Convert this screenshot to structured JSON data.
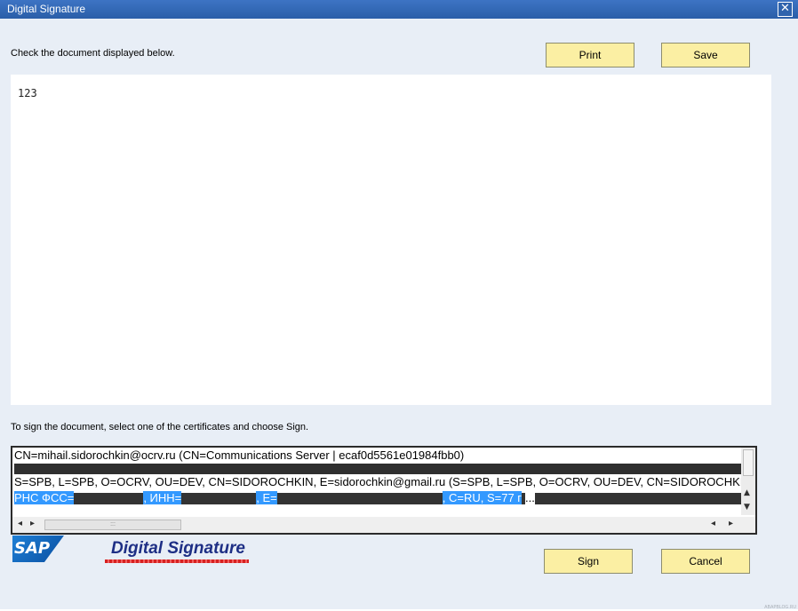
{
  "window": {
    "title": "Digital Signature",
    "close_glyph": "✕"
  },
  "instructions": {
    "check": "Check the document displayed below.",
    "sign": "To sign the document, select one of the certificates and choose Sign."
  },
  "toolbar": {
    "print_label": "Print",
    "save_label": "Save"
  },
  "document": {
    "content": "123"
  },
  "certificates": [
    {
      "text": "CN=mihail.sidorochkin@ocrv.ru (CN=Communications Server | ecaf0d5561e01984fbb0)"
    },
    {
      "text": "S=SPB, L=SPB, O=OCRV, OU=DEV, CN=SIDOROCHKIN, E=sidorochkin@gmail.ru (S=SPB, L=SPB, O=OCRV, OU=DEV, CN=SIDOROCHKIN"
    },
    {
      "part1": "РНС ФСС=",
      "part2": ", ИНН=",
      "part3": ", E=",
      "part4": ", C=RU, S=77 г",
      "part5": "..."
    }
  ],
  "footer": {
    "sap_logo": "SAP",
    "brand": "Digital Signature",
    "sign_label": "Sign",
    "cancel_label": "Cancel",
    "watermark": "ABAPBLOG.RU"
  },
  "colors": {
    "title_bar": "#2f63ad",
    "dialog_bg": "#e8eef6",
    "button_bg": "#fbefa3",
    "selection": "#3399ff",
    "brand_text": "#1e2f85"
  }
}
